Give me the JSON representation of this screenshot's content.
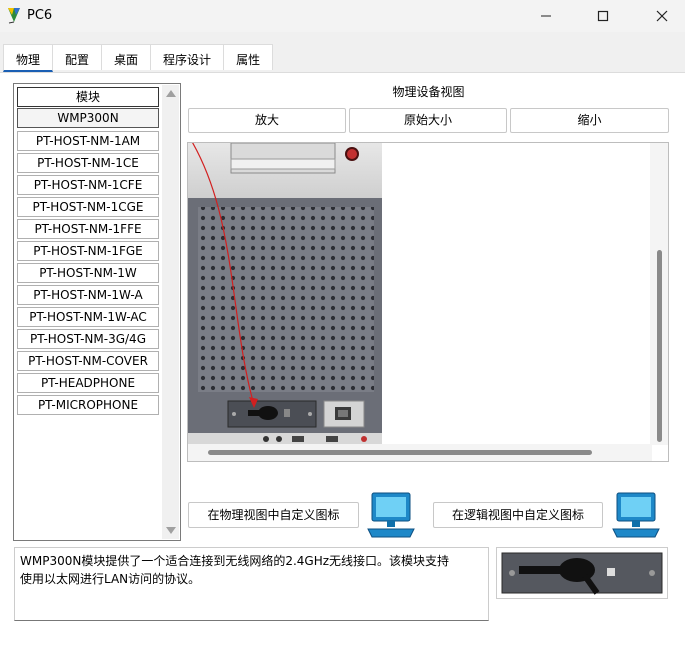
{
  "window": {
    "title": "PC6"
  },
  "tabs": [
    {
      "label": "物理"
    },
    {
      "label": "配置"
    },
    {
      "label": "桌面"
    },
    {
      "label": "程序设计"
    },
    {
      "label": "属性"
    }
  ],
  "modules": {
    "header": "模块",
    "items": [
      "WMP300N",
      "PT-HOST-NM-1AM",
      "PT-HOST-NM-1CE",
      "PT-HOST-NM-1CFE",
      "PT-HOST-NM-1CGE",
      "PT-HOST-NM-1FFE",
      "PT-HOST-NM-1FGE",
      "PT-HOST-NM-1W",
      "PT-HOST-NM-1W-A",
      "PT-HOST-NM-1W-AC",
      "PT-HOST-NM-3G/4G",
      "PT-HOST-NM-COVER",
      "PT-HEADPHONE",
      "PT-MICROPHONE"
    ],
    "selected": "WMP300N"
  },
  "view": {
    "title": "物理设备视图",
    "zoom_in": "放大",
    "original_size": "原始大小",
    "zoom_out": "缩小"
  },
  "actions": {
    "custom_physical_icon": "在物理视图中自定义图标",
    "custom_logical_icon": "在逻辑视图中自定义图标"
  },
  "description": {
    "line1": "WMP300N模块提供了一个适合连接到无线网络的2.4GHz无线接口。该模块支持",
    "line2": "使用以太网进行LAN访问的协议。"
  },
  "colors": {
    "accent": "#1a5fb4",
    "annotation_arrow": "#d22020"
  }
}
